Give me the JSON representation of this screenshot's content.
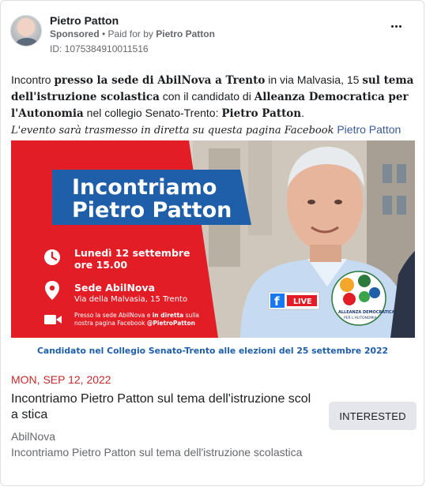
{
  "post": {
    "page_name": "Pietro Patton",
    "sponsored": "Sponsored",
    "separator": " • ",
    "paid_for_prefix": "Paid for by ",
    "paid_for_by": "Pietro Patton",
    "ad_id": "ID: 1075384910011516",
    "more_icon": "more-horizontal-icon"
  },
  "body": {
    "t1": "Incontro ",
    "b1": "presso la sede di AbilNova a Trento",
    "t2": " in via Malvasia, 15 ",
    "b2": "sul tema dell'istruzione scolastica",
    "t3": " con il candidato di ",
    "b3": "Alleanza Democratica per l'Autonomia",
    "t4": " nel collegio Senato-Trento: ",
    "b4": "Pietro Patton",
    "t5": ".",
    "italic": "L'evento sarà trasmesso in diretta su questa pagina Facebook",
    "link": " Pietro Patton"
  },
  "creative": {
    "headline_line1": "Incontriamo",
    "headline_line2": "Pietro Patton",
    "date_line1": "Lunedì 12 settembre",
    "date_line2": "ore 15.00",
    "venue_title": "Sede AbilNova",
    "venue_address": "Via della Malvasia, 15 Trento",
    "stream_line1_a": "Presso la sede AbilNova e ",
    "stream_line1_b": "in diretta",
    "stream_line1_c": " sulla",
    "stream_line2_a": "nostra pagina Facebook ",
    "stream_line2_b": "@PietroPatton",
    "live_label": "LIVE",
    "logo_text_1": "ALLEANZA DEMOCRATICA",
    "logo_text_2": "PER L'AUTONOMIA",
    "footer": "Candidato nel Collegio Senato-Trento alle elezioni del 25 settembre 2022",
    "colors": {
      "red": "#e21d26",
      "blue": "#1f5ea8",
      "white": "#ffffff",
      "navy": "#1a3a73"
    }
  },
  "event": {
    "date": "MON, SEP 12, 2022",
    "title": "Incontriamo Pietro Patton sul tema dell'istruzione scola stica",
    "organizer": "AbilNova",
    "description": "Incontriamo Pietro Patton sul tema dell'istruzione scolastica",
    "button_label": "INTERESTED"
  }
}
